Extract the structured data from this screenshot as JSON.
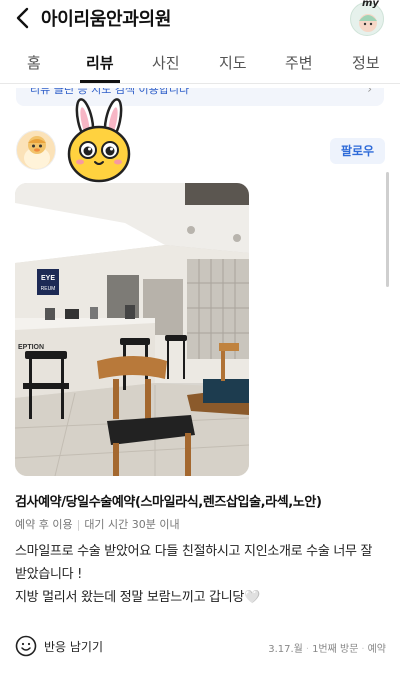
{
  "header": {
    "title": "아이리움안과의원",
    "my_badge": "my"
  },
  "tabs": [
    {
      "label": "홈"
    },
    {
      "label": "리뷰"
    },
    {
      "label": "사진"
    },
    {
      "label": "지도"
    },
    {
      "label": "주변"
    },
    {
      "label": "정보"
    }
  ],
  "active_tab": "리뷰",
  "info_bar": {
    "text": "리뷰 클린 등 지도 검색 이용합니다"
  },
  "review": {
    "follow_label": "팔로우",
    "visit_title": "검사예약/당일수술예약(스마일라식,렌즈삽입술,라섹,노안)",
    "meta_type": "예약 후 이용",
    "meta_wait": "대기 시간 30분 이내",
    "body_lines": [
      "스마일프로 수술 받았어요 다들 친절하시고 지인소개로 수술 너무 잘",
      "받았습니다 !",
      "지방 멀리서 왔는데 정말 보람느끼고 갑니당🤍"
    ],
    "react_label": "반응 남기기",
    "date": "3.17.월",
    "visit_count": "1번째 방문",
    "visit_kind": "예약"
  },
  "photo_sign": {
    "line1": "EYE",
    "line2": "REUM",
    "reception": "EPTION"
  },
  "colors": {
    "accent_blue": "#2f6bd8",
    "follow_bg": "#eef3fc"
  }
}
